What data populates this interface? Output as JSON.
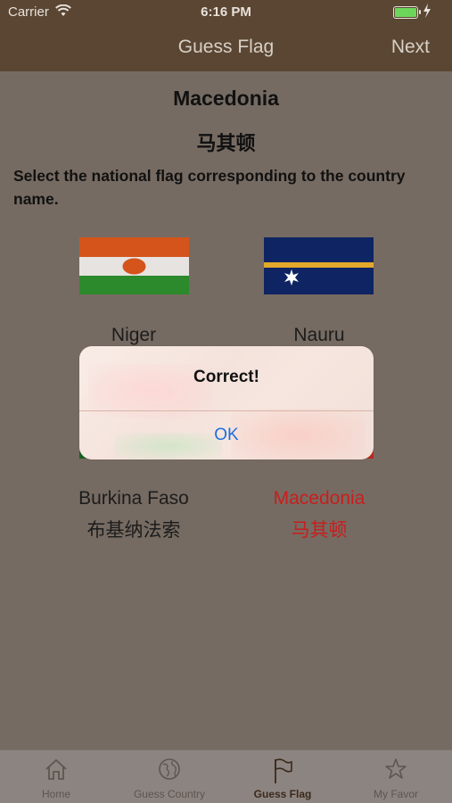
{
  "status_bar": {
    "carrier": "Carrier",
    "time": "6:16 PM"
  },
  "nav": {
    "title": "Guess Flag",
    "next": "Next"
  },
  "question": {
    "country": "Macedonia",
    "country_cn": "马其顿",
    "instruction": "Select the national flag corresponding to the country name."
  },
  "options": [
    {
      "name": "Niger",
      "name_cn": ""
    },
    {
      "name": "Nauru",
      "name_cn": ""
    },
    {
      "name": "Burkina Faso",
      "name_cn": "布基纳法索"
    },
    {
      "name": "Macedonia",
      "name_cn": "马其顿"
    }
  ],
  "alert": {
    "title": "Correct!",
    "ok": "OK"
  },
  "tabs": [
    {
      "label": "Home",
      "icon": "home-icon"
    },
    {
      "label": "Guess Country",
      "icon": "globe-icon"
    },
    {
      "label": "Guess Flag",
      "icon": "flag-icon"
    },
    {
      "label": "My Favor",
      "icon": "star-icon"
    }
  ],
  "colors": {
    "nav_bg": "#5a4633",
    "body_bg": "#766b62",
    "correct": "#c81e1e",
    "link": "#1d6fe0"
  }
}
